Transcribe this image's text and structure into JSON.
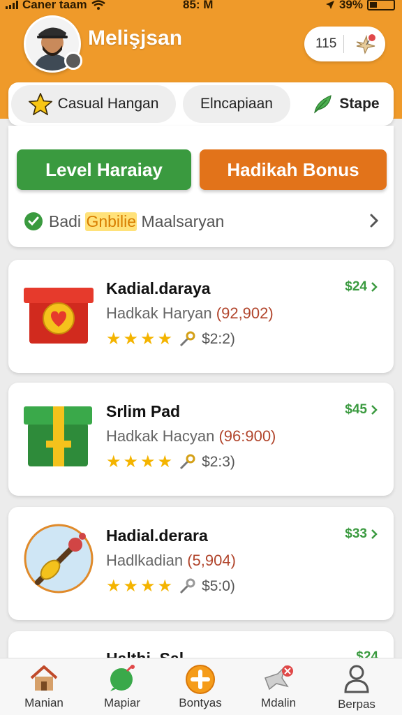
{
  "status_bar": {
    "carrier": "Caner taam",
    "time": "85: M",
    "battery_text": "39%"
  },
  "profile": {
    "username": "Melişjsan"
  },
  "counter": {
    "value": "115"
  },
  "tabs": [
    {
      "label": "Casual Hangan"
    },
    {
      "label": "Elncapiaan"
    },
    {
      "label": "Stape"
    }
  ],
  "actions": {
    "level_button": "Level Haraiay",
    "bonus_button": "Hadikah Bonus"
  },
  "info": {
    "prefix": "Badi",
    "highlight": "Gnbilie",
    "suffix": "Maalsaryan"
  },
  "products": [
    {
      "title": "Kadial.daraya",
      "subtitle": "Hadkak Haryan",
      "paren": "(92,902)",
      "price": "$24",
      "rating_text": "$2:2)",
      "stars": 4
    },
    {
      "title": "Srlim Pad",
      "subtitle": "Hadkak Ηacyan",
      "paren": "(96:900)",
      "price": "$45",
      "rating_text": "$2:3)",
      "stars": 4
    },
    {
      "title": "Hadial.derara",
      "subtitle": "Hadlkadian",
      "paren": "(5,904)",
      "price": "$33",
      "rating_text": "$5:0)",
      "stars": 4
    },
    {
      "title": "Halthi..Sal",
      "price": "$24"
    }
  ],
  "nav": [
    {
      "label": "Manian"
    },
    {
      "label": "Mapiar"
    },
    {
      "label": "Bontyas"
    },
    {
      "label": "Mdalin"
    },
    {
      "label": "Berpas"
    }
  ],
  "colors": {
    "header": "#ef9a2a",
    "green": "#3a9a3f",
    "orange": "#e2731a",
    "star": "#f4b400"
  }
}
